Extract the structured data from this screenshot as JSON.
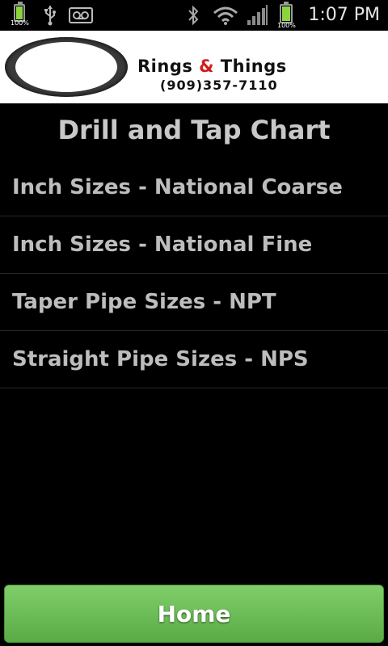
{
  "status_bar": {
    "battery_left_label": "100%",
    "battery_right_label": "100%",
    "time": "1:07 PM",
    "icons": [
      "battery-icon",
      "usb-icon",
      "voicemail-icon",
      "bluetooth-icon",
      "wifi-icon",
      "signal-icon",
      "battery-icon"
    ]
  },
  "banner": {
    "brand_part1": "Rings ",
    "brand_amp": "&",
    "brand_part2": " Things",
    "phone": "(909)357-7110",
    "accent_color": "#d11c1c"
  },
  "page": {
    "title": "Drill and Tap Chart"
  },
  "menu": {
    "items": [
      {
        "label": "Inch Sizes - National Coarse"
      },
      {
        "label": "Inch Sizes - National Fine"
      },
      {
        "label": "Taper Pipe Sizes - NPT"
      },
      {
        "label": "Straight Pipe Sizes - NPS"
      }
    ]
  },
  "footer": {
    "home_label": "Home",
    "home_color": "#6cbd57"
  }
}
